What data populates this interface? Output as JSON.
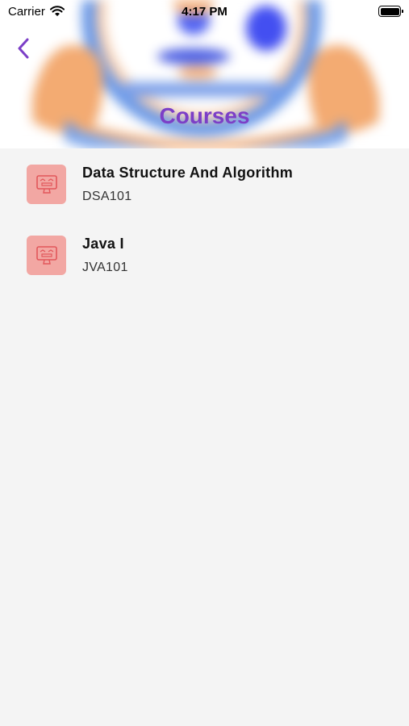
{
  "status_bar": {
    "carrier": "Carrier",
    "time": "4:17 PM"
  },
  "header": {
    "title": "Courses",
    "back_icon": "chevron-left-icon",
    "accent_color": "#7c3fc7"
  },
  "courses": [
    {
      "title": "Data Structure And Algorithm",
      "code": "DSA101",
      "icon": "computer-monitor-icon"
    },
    {
      "title": "Java I",
      "code": "JVA101",
      "icon": "computer-monitor-icon"
    }
  ]
}
